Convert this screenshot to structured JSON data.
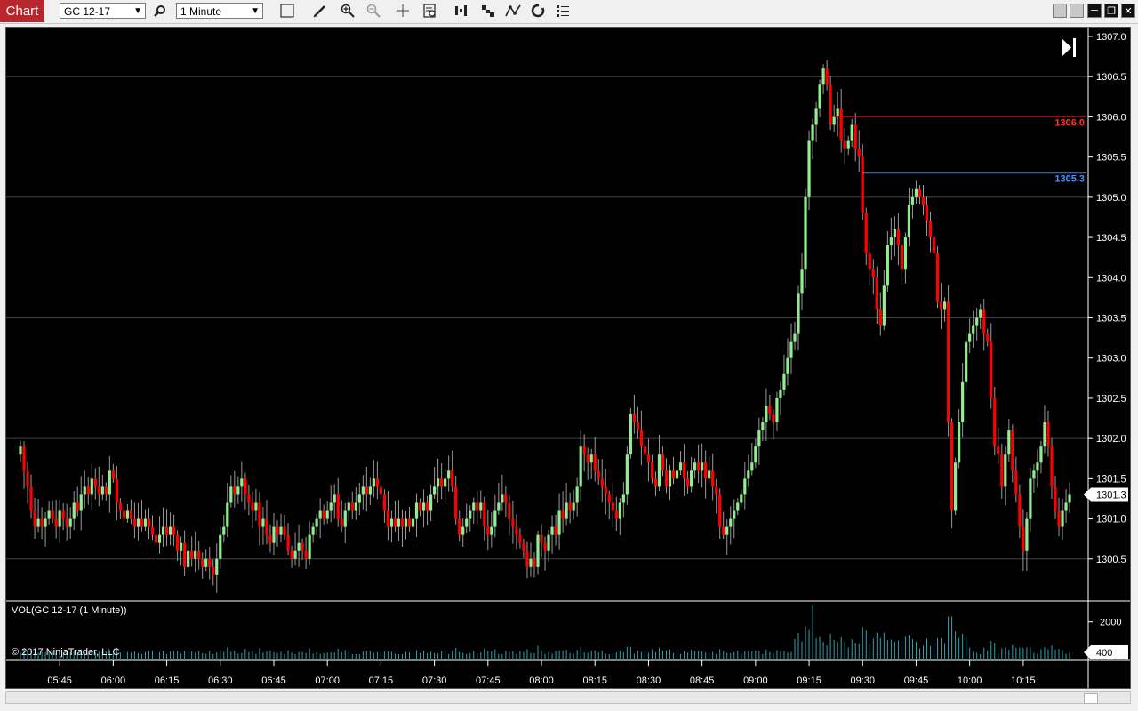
{
  "toolbar": {
    "tab_label": "Chart",
    "instrument": "GC 12-17",
    "interval": "1 Minute",
    "icons": [
      "search-icon",
      "bar-style-icon",
      "draw-tool-icon",
      "zoom-in-icon",
      "zoom-out-icon",
      "crosshair-icon",
      "data-box-icon",
      "indicators-icon",
      "strategies-icon",
      "drawing-objects-icon",
      "properties-icon",
      "menu-icon"
    ]
  },
  "chart": {
    "copyright": "© 2017 NinjaTrader, LLC",
    "volume_label": "VOL(GC 12-17 (1 Minute))",
    "current_price_label": "1301.3",
    "current_volume_label": "400",
    "red_line_label": "1306.0",
    "blue_line_label": "1305.3",
    "colors": {
      "up": "#90ee90",
      "down": "#ff0000",
      "red_line": "#d00000",
      "blue_line": "#3a7fd5",
      "volume": "#2aa4b0",
      "grid": "#444444",
      "axis_text": "#ffffff",
      "background": "#000000"
    }
  },
  "chart_data": {
    "type": "candlestick",
    "y_ticks": [
      1307.0,
      1306.5,
      1306.0,
      1305.5,
      1305.0,
      1304.5,
      1304.0,
      1303.5,
      1303.0,
      1302.5,
      1302.0,
      1301.5,
      1301.0,
      1300.5
    ],
    "y_tick_labels": [
      "1307.0",
      "1306.5",
      "1306.0",
      "1305.5",
      "1305.0",
      "1304.5",
      "1304.0",
      "1303.5",
      "1303.0",
      "1302.5",
      "1302.0",
      "1301.5",
      "1301.0",
      "1300.5"
    ],
    "ylim": [
      1300.0,
      1307.1
    ],
    "x_ticks": [
      "05:45",
      "06:00",
      "06:15",
      "06:30",
      "06:45",
      "07:00",
      "07:15",
      "07:30",
      "07:45",
      "08:00",
      "08:15",
      "08:30",
      "08:45",
      "09:00",
      "09:15",
      "09:30",
      "09:45",
      "10:00",
      "10:15"
    ],
    "x_tick_minutes": [
      345,
      360,
      375,
      390,
      405,
      420,
      435,
      450,
      465,
      480,
      495,
      510,
      525,
      540,
      555,
      570,
      585,
      600,
      615
    ],
    "first_bar_minute": 334,
    "path": [
      [
        334,
        1301.8
      ],
      [
        336,
        1301.4
      ],
      [
        338,
        1301.0
      ],
      [
        340,
        1300.9
      ],
      [
        342,
        1301.1
      ],
      [
        344,
        1301.0
      ],
      [
        346,
        1301.1
      ],
      [
        348,
        1301.0
      ],
      [
        350,
        1301.2
      ],
      [
        352,
        1301.3
      ],
      [
        354,
        1301.5
      ],
      [
        356,
        1301.4
      ],
      [
        358,
        1301.3
      ],
      [
        359,
        1301.6
      ],
      [
        361,
        1301.3
      ],
      [
        363,
        1301.2
      ],
      [
        365,
        1301.1
      ],
      [
        367,
        1300.9
      ],
      [
        369,
        1301.1
      ],
      [
        371,
        1300.8
      ],
      [
        373,
        1300.7
      ],
      [
        375,
        1300.8
      ],
      [
        377,
        1300.7
      ],
      [
        379,
        1300.5
      ],
      [
        381,
        1300.5
      ],
      [
        383,
        1300.6
      ],
      [
        385,
        1300.5
      ],
      [
        387,
        1300.4
      ],
      [
        389,
        1300.6
      ],
      [
        391,
        1300.9
      ],
      [
        393,
        1301.3
      ],
      [
        395,
        1301.4
      ],
      [
        397,
        1301.3
      ],
      [
        399,
        1301.2
      ],
      [
        401,
        1301.0
      ],
      [
        403,
        1300.9
      ],
      [
        405,
        1300.8
      ],
      [
        407,
        1300.9
      ],
      [
        409,
        1300.6
      ],
      [
        411,
        1300.5
      ],
      [
        413,
        1300.5
      ],
      [
        415,
        1300.7
      ],
      [
        417,
        1301.0
      ],
      [
        419,
        1301.1
      ],
      [
        421,
        1301.2
      ],
      [
        423,
        1301.0
      ],
      [
        425,
        1301.1
      ],
      [
        427,
        1301.2
      ],
      [
        429,
        1301.3
      ],
      [
        431,
        1301.4
      ],
      [
        433,
        1301.5
      ],
      [
        435,
        1301.3
      ],
      [
        437,
        1301.0
      ],
      [
        439,
        1300.9
      ],
      [
        441,
        1301.1
      ],
      [
        443,
        1301.1
      ],
      [
        445,
        1301.1
      ],
      [
        447,
        1301.1
      ],
      [
        449,
        1301.2
      ],
      [
        451,
        1301.4
      ],
      [
        453,
        1301.5
      ],
      [
        455,
        1301.3
      ],
      [
        457,
        1300.8
      ],
      [
        459,
        1301.1
      ],
      [
        461,
        1301.2
      ],
      [
        463,
        1301.1
      ],
      [
        465,
        1300.9
      ],
      [
        467,
        1301.0
      ],
      [
        469,
        1301.2
      ],
      [
        471,
        1301.1
      ],
      [
        473,
        1300.8
      ],
      [
        475,
        1300.6
      ],
      [
        477,
        1300.4
      ],
      [
        479,
        1300.8
      ],
      [
        481,
        1300.7
      ],
      [
        483,
        1300.8
      ],
      [
        485,
        1301.0
      ],
      [
        487,
        1301.2
      ],
      [
        489,
        1301.1
      ],
      [
        491,
        1301.8
      ],
      [
        493,
        1301.7
      ],
      [
        495,
        1301.6
      ],
      [
        497,
        1301.5
      ],
      [
        499,
        1301.3
      ],
      [
        501,
        1301.1
      ],
      [
        503,
        1301.4
      ],
      [
        505,
        1302.3
      ],
      [
        507,
        1302.1
      ],
      [
        509,
        1301.8
      ],
      [
        511,
        1301.5
      ],
      [
        513,
        1301.7
      ],
      [
        515,
        1301.4
      ],
      [
        517,
        1301.6
      ],
      [
        519,
        1301.5
      ],
      [
        521,
        1301.4
      ],
      [
        523,
        1301.7
      ],
      [
        525,
        1301.6
      ],
      [
        527,
        1301.5
      ],
      [
        529,
        1301.2
      ],
      [
        531,
        1300.8
      ],
      [
        533,
        1300.9
      ],
      [
        535,
        1301.1
      ],
      [
        537,
        1301.4
      ],
      [
        539,
        1301.6
      ],
      [
        541,
        1302.1
      ],
      [
        543,
        1302.4
      ],
      [
        545,
        1302.3
      ],
      [
        547,
        1302.6
      ],
      [
        549,
        1302.9
      ],
      [
        551,
        1303.4
      ],
      [
        553,
        1304.2
      ],
      [
        555,
        1305.6
      ],
      [
        557,
        1306.2
      ],
      [
        559,
        1306.6
      ],
      [
        561,
        1306.0
      ],
      [
        563,
        1305.9
      ],
      [
        565,
        1305.6
      ],
      [
        567,
        1305.8
      ],
      [
        569,
        1305.4
      ],
      [
        571,
        1304.3
      ],
      [
        573,
        1303.9
      ],
      [
        575,
        1303.5
      ],
      [
        577,
        1304.5
      ],
      [
        579,
        1304.6
      ],
      [
        581,
        1304.1
      ],
      [
        583,
        1305.0
      ],
      [
        585,
        1305.2
      ],
      [
        587,
        1304.8
      ],
      [
        589,
        1304.6
      ],
      [
        591,
        1303.8
      ],
      [
        593,
        1303.5
      ],
      [
        595,
        1301.0
      ],
      [
        597,
        1302.3
      ],
      [
        599,
        1303.2
      ],
      [
        601,
        1303.3
      ],
      [
        603,
        1303.6
      ],
      [
        605,
        1303.1
      ],
      [
        607,
        1302.0
      ],
      [
        609,
        1301.5
      ],
      [
        611,
        1302.1
      ],
      [
        613,
        1301.3
      ],
      [
        615,
        1300.6
      ],
      [
        617,
        1301.5
      ],
      [
        619,
        1301.7
      ],
      [
        621,
        1302.2
      ],
      [
        623,
        1301.5
      ],
      [
        625,
        1300.9
      ],
      [
        627,
        1301.2
      ],
      [
        628,
        1301.3
      ]
    ],
    "price_lines": [
      {
        "price": 1306.0,
        "label": "1306.0",
        "color": "red"
      },
      {
        "price": 1305.3,
        "label": "1305.3",
        "color": "blue"
      }
    ],
    "current_price": 1301.3,
    "volume_ticks": [
      2000,
      400
    ],
    "volume_tick_labels": [
      "2000",
      "400"
    ],
    "volume_max": 3000
  }
}
